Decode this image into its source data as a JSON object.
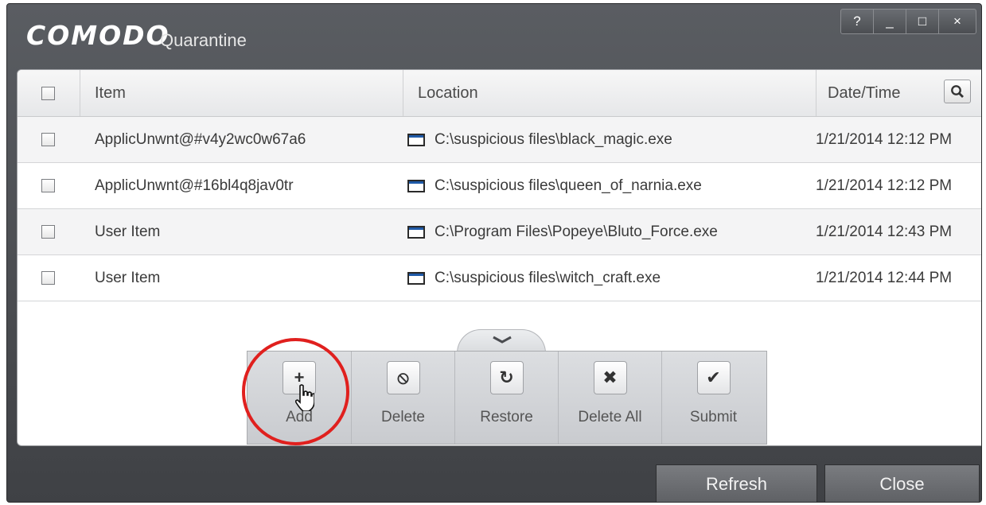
{
  "window": {
    "brand": "COMODO",
    "title": "Quarantine",
    "controls": {
      "help": "?",
      "minimize": "_",
      "maximize": "□",
      "close": "×"
    }
  },
  "table": {
    "columns": {
      "item": "Item",
      "location": "Location",
      "datetime": "Date/Time"
    },
    "rows": [
      {
        "item": "ApplicUnwnt@#v4y2wc0w67a6",
        "location": "C:\\suspicious files\\black_magic.exe",
        "datetime": "1/21/2014 12:12 PM"
      },
      {
        "item": "ApplicUnwnt@#16bl4q8jav0tr",
        "location": "C:\\suspicious files\\queen_of_narnia.exe",
        "datetime": "1/21/2014 12:12 PM"
      },
      {
        "item": "User Item",
        "location": "C:\\Program Files\\Popeye\\Bluto_Force.exe",
        "datetime": "1/21/2014 12:43 PM"
      },
      {
        "item": "User Item",
        "location": "C:\\suspicious files\\witch_craft.exe",
        "datetime": "1/21/2014 12:44 PM"
      }
    ]
  },
  "toolbar": {
    "items": [
      {
        "label": "Add",
        "glyph": "+"
      },
      {
        "label": "Delete",
        "glyph": "⦸"
      },
      {
        "label": "Restore",
        "glyph": "↻"
      },
      {
        "label": "Delete All",
        "glyph": "✖"
      },
      {
        "label": "Submit",
        "glyph": "✔"
      }
    ]
  },
  "footer": {
    "refresh": "Refresh",
    "close": "Close"
  },
  "colors": {
    "highlight": "#e0201e",
    "chrome": "#4a4c50"
  }
}
